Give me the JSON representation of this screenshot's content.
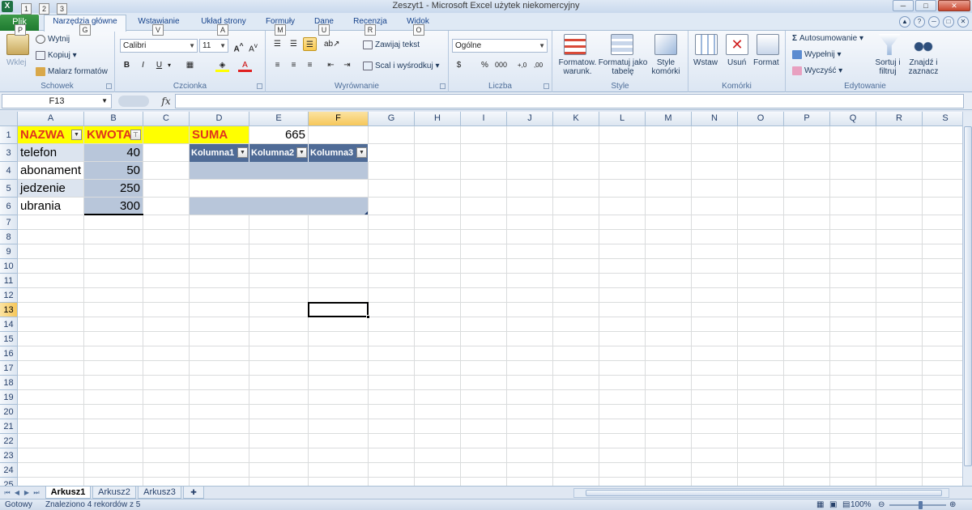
{
  "window": {
    "title": "Zeszyt1 - Microsoft Excel użytek niekomercyjny",
    "app_icon": "X",
    "qat_keys": [
      "1",
      "2",
      "3"
    ],
    "controls": [
      "─",
      "□",
      "✕"
    ]
  },
  "tabs": [
    {
      "label": "Plik",
      "key": "P"
    },
    {
      "label": "Narzędzia główne",
      "key": "G"
    },
    {
      "label": "Wstawianie",
      "key": "V"
    },
    {
      "label": "Układ strony",
      "key": "A"
    },
    {
      "label": "Formuły",
      "key": "M"
    },
    {
      "label": "Dane",
      "key": "U"
    },
    {
      "label": "Recenzja",
      "key": "R"
    },
    {
      "label": "Widok",
      "key": "O"
    }
  ],
  "ribbon": {
    "clipboard": {
      "label": "Schowek",
      "paste": "Wklej",
      "cut": "Wytnij",
      "copy": "Kopiuj",
      "format_painter": "Malarz formatów"
    },
    "font": {
      "label": "Czcionka",
      "name": "Calibri",
      "size": "11",
      "bold": "B",
      "italic": "I",
      "underline": "U"
    },
    "alignment": {
      "label": "Wyrównanie",
      "wrap": "Zawijaj tekst",
      "merge": "Scal i wyśrodkuj"
    },
    "number": {
      "label": "Liczba",
      "format": "Ogólne",
      "currency": "$",
      "percent": "%",
      "thousands": "000",
      "inc_dec": "+,0",
      "dec_dec": ",00"
    },
    "styles": {
      "label": "Style",
      "conditional": "Formatow. warunk.",
      "as_table": "Formatuj jako tabelę",
      "cell_styles": "Style komórki"
    },
    "cells": {
      "label": "Komórki",
      "insert": "Wstaw",
      "delete": "Usuń",
      "format": "Format"
    },
    "editing": {
      "label": "Edytowanie",
      "autosum": "Autosumowanie",
      "fill": "Wypełnij",
      "clear": "Wyczyść",
      "sort": "Sortuj i filtruj",
      "find": "Znajdź i zaznacz"
    }
  },
  "formula_bar": {
    "name_box": "F13",
    "fx": "fx",
    "formula": ""
  },
  "columns": [
    "A",
    "B",
    "C",
    "D",
    "E",
    "F",
    "G",
    "H",
    "I",
    "J",
    "K",
    "L",
    "M",
    "N",
    "O",
    "P",
    "Q",
    "R",
    "S"
  ],
  "rows": [
    "1",
    "3",
    "4",
    "5",
    "6",
    "7",
    "8",
    "9",
    "10",
    "11",
    "12",
    "13",
    "14",
    "15",
    "16",
    "17",
    "18",
    "19",
    "20",
    "21",
    "22",
    "23",
    "24",
    "25"
  ],
  "cells": {
    "A1": "NAZWA",
    "B1": "KWOTA",
    "D1": "SUMA",
    "E1": "665",
    "A3": "telefon",
    "B3": "40",
    "A4": "abonament",
    "B4": "50",
    "A5": "jedzenie",
    "B5": "250",
    "A6": "ubrania",
    "B6": "300"
  },
  "table2_headers": [
    "Kolumna1",
    "Kolumna2",
    "Kolumna3"
  ],
  "sheets": [
    "Arkusz1",
    "Arkusz2",
    "Arkusz3"
  ],
  "status": {
    "ready": "Gotowy",
    "message": "Znaleziono 4 rekordów z 5",
    "zoom": "100%"
  },
  "colors": {
    "header_yellow": "#ffff00",
    "header_red": "#e0341f",
    "table_blue": "#b8c6da",
    "table_header": "#4f6b96",
    "excel_green": "#1f7244"
  }
}
